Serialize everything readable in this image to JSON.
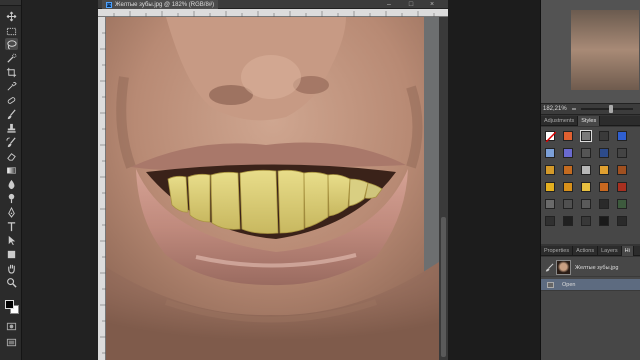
{
  "document": {
    "tab_title": "Желтые зубы.jpg @ 182% (RGB/8#)",
    "ps_mark": "Ps",
    "window_buttons": [
      "–",
      "□",
      "×"
    ]
  },
  "toolbar": {
    "tools": [
      "move-icon",
      "marquee-icon",
      "lasso-icon",
      "quick-select-icon",
      "crop-icon",
      "eyedropper-icon",
      "spot-heal-icon",
      "brush-icon",
      "clone-stamp-icon",
      "history-brush-icon",
      "eraser-icon",
      "gradient-icon",
      "blur-icon",
      "dodge-icon",
      "pen-icon",
      "type-icon",
      "path-select-icon",
      "shape-icon",
      "hand-icon",
      "zoom-icon"
    ],
    "active_tool": "lasso-icon"
  },
  "navigator": {
    "zoom_value": "182,21%"
  },
  "styles_panel": {
    "tabs": [
      "Adjustments",
      "Styles"
    ],
    "active_tab": "Styles"
  },
  "history_panel": {
    "tabs": [
      "Properties",
      "Actions",
      "Layers",
      "Hi"
    ],
    "active_tab": "Hi",
    "snapshot_label": "Желтые зубы.jpg",
    "states": [
      "Open"
    ],
    "selected_state": "Open"
  },
  "colors": {
    "accent_selection": "#5d6b80",
    "foreground": "#000000",
    "background": "#ffffff"
  }
}
